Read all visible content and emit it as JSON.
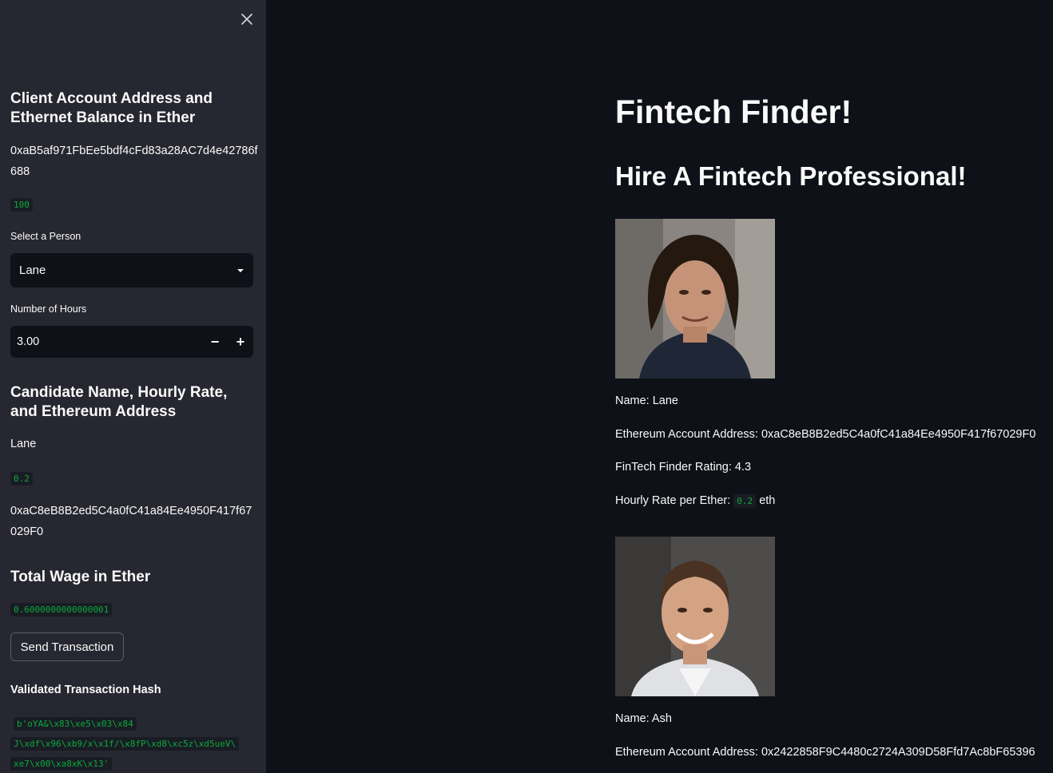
{
  "sidebar": {
    "client_heading": "Client Account Address and Ethernet Balance in Ether",
    "client_address": "0xaB5af971FbEe5bdf4cFd83a28AC7d4e42786f688",
    "client_balance": "100",
    "select_label": "Select a Person",
    "selected_person": "Lane",
    "hours_label": "Number of Hours",
    "hours_value": "3.00",
    "candidate_heading": "Candidate Name, Hourly Rate, and Ethereum Address",
    "candidate_name": "Lane",
    "candidate_rate": "0.2",
    "candidate_address": "0xaC8eB8B2ed5C4a0fC41a84Ee4950F417f67029F0",
    "wage_heading": "Total Wage in Ether",
    "wage_value": "0.6000000000000001",
    "send_button": "Send Transaction",
    "hash_heading": "Validated Transaction Hash",
    "hash_lines": [
      "b'oYA&\\x83\\xe5\\x03\\x84",
      "J\\xdf\\x96\\xb9/x\\x1f/\\x8fP\\xd8\\xc5z\\xd5ueV\\",
      "xe7\\x00\\xa8xK\\x13'"
    ]
  },
  "main": {
    "title": "Fintech Finder!",
    "subtitle": "Hire A Fintech Professional!",
    "candidates": [
      {
        "name_line": "Name: Lane",
        "address_line": "Ethereum Account Address: 0xaC8eB8B2ed5C4a0fC41a84Ee4950F417f67029F0",
        "rating_line": "FinTech Finder Rating: 4.3",
        "rate_prefix": "Hourly Rate per Ether:",
        "rate_value": "0.2",
        "rate_suffix": "eth"
      },
      {
        "name_line": "Name: Ash",
        "address_line": "Ethereum Account Address: 0x2422858F9C4480c2724A309D58Ffd7Ac8bF65396"
      }
    ]
  },
  "colors": {
    "background": "#0e1117",
    "sidebar": "#262730",
    "code_green": "#09ab3b"
  }
}
